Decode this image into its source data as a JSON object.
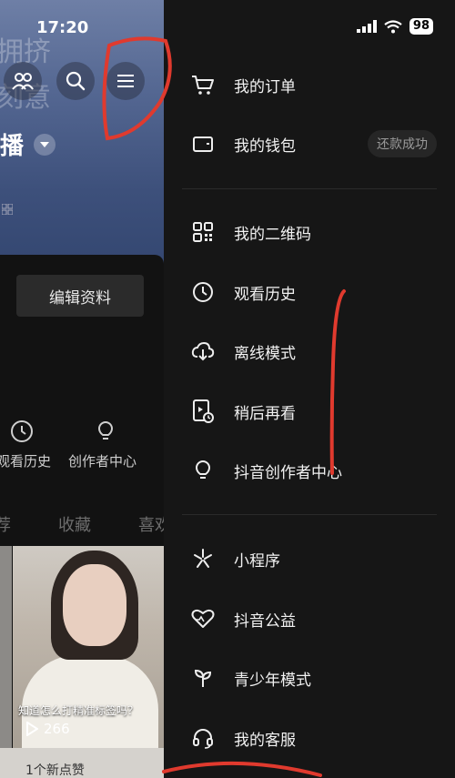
{
  "status": {
    "time": "17:20",
    "battery": "98"
  },
  "background_page": {
    "live_label": "播",
    "edit_profile_button": "编辑资料",
    "tools": [
      {
        "label": "观看历史",
        "icon": "clock-icon"
      },
      {
        "label": "创作者中心",
        "icon": "bulb-icon"
      }
    ],
    "tabs": [
      "荐",
      "收藏",
      "喜欢"
    ],
    "video": {
      "caption": "知道怎么打精准标签吗？",
      "plays": "266"
    },
    "new_likes": "1个新点赞"
  },
  "drawer": {
    "groups": [
      [
        {
          "label": "我的订单",
          "icon": "cart-icon"
        },
        {
          "label": "我的钱包",
          "icon": "wallet-icon",
          "badge": "还款成功"
        }
      ],
      [
        {
          "label": "我的二维码",
          "icon": "qrcode-icon"
        },
        {
          "label": "观看历史",
          "icon": "clock-icon"
        },
        {
          "label": "离线模式",
          "icon": "cloud-download-icon"
        },
        {
          "label": "稍后再看",
          "icon": "watch-later-icon"
        },
        {
          "label": "抖音创作者中心",
          "icon": "bulb-icon"
        }
      ],
      [
        {
          "label": "小程序",
          "icon": "mini-program-icon"
        },
        {
          "label": "抖音公益",
          "icon": "charity-heart-icon"
        },
        {
          "label": "青少年模式",
          "icon": "sprout-icon"
        },
        {
          "label": "我的客服",
          "icon": "headset-icon"
        }
      ]
    ]
  },
  "colors": {
    "drawer_bg": "#161616",
    "text": "#f2f2f2",
    "annotation": "#e03a2e"
  }
}
